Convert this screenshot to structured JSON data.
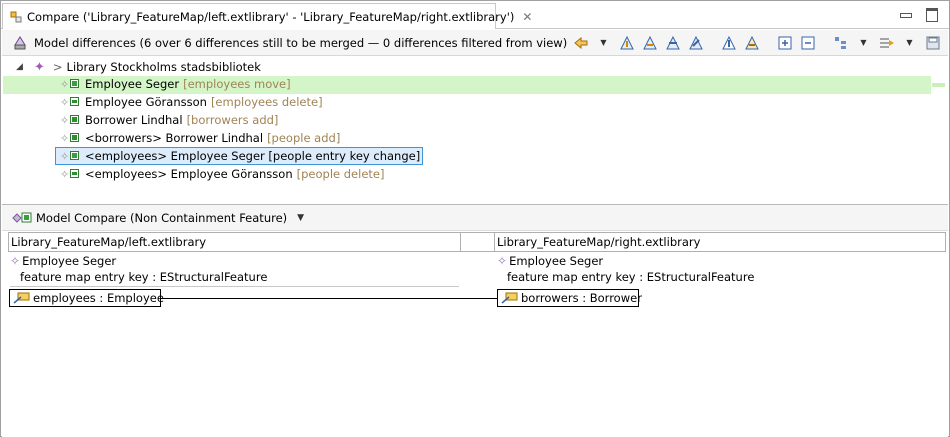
{
  "tab": {
    "title": "Compare ('Library_FeatureMap/left.extlibrary' - 'Library_FeatureMap/right.extlibrary')",
    "close_glyph": "✕"
  },
  "header": {
    "title": "Model differences  (6 over 6 differences still to be merged — 0 differences filtered from view)",
    "toolbar_icons": [
      "previous-icon",
      "next-icon",
      "merge-left-icon",
      "merge-right-icon",
      "accept-icon",
      "reject-icon",
      "expand-icon",
      "collapse-icon",
      "group-icon",
      "filter-icon",
      "save-icon"
    ]
  },
  "tree": {
    "root": {
      "label": "Library Stockholms stadsbibliotek",
      "arrow": ">"
    },
    "items": [
      {
        "label": "Employee Seger",
        "hint": "[employees move]",
        "kind": "move"
      },
      {
        "label": "Employee Göransson",
        "hint": "[employees delete]",
        "kind": "del"
      },
      {
        "label": "Borrower Lindhal",
        "hint": "[borrowers add]",
        "kind": "add"
      },
      {
        "label": "<borrowers> Borrower Lindhal",
        "hint": "[people add]",
        "kind": "add"
      },
      {
        "label": "<employees> Employee Seger [people entry key change]",
        "hint": "",
        "kind": "change"
      },
      {
        "label": "<employees> Employee Göransson",
        "hint": "[people delete]",
        "kind": "del"
      }
    ]
  },
  "compare": {
    "title": "Model Compare (Non Containment Feature)",
    "left_header": "Library_FeatureMap/left.extlibrary",
    "right_header": "Library_FeatureMap/right.extlibrary",
    "left": {
      "entry": "Employee Seger",
      "key": "feature map entry key : EStructuralFeature",
      "value": "employees : Employee"
    },
    "right": {
      "entry": "Employee Seger",
      "key": "feature map entry key : EStructuralFeature",
      "value": "borrowers : Borrower"
    }
  },
  "colors": {
    "highlight": "#d4f5c8",
    "hint": "#a08355",
    "selection": "#dcecfb",
    "diamond": "#a35bb8"
  }
}
